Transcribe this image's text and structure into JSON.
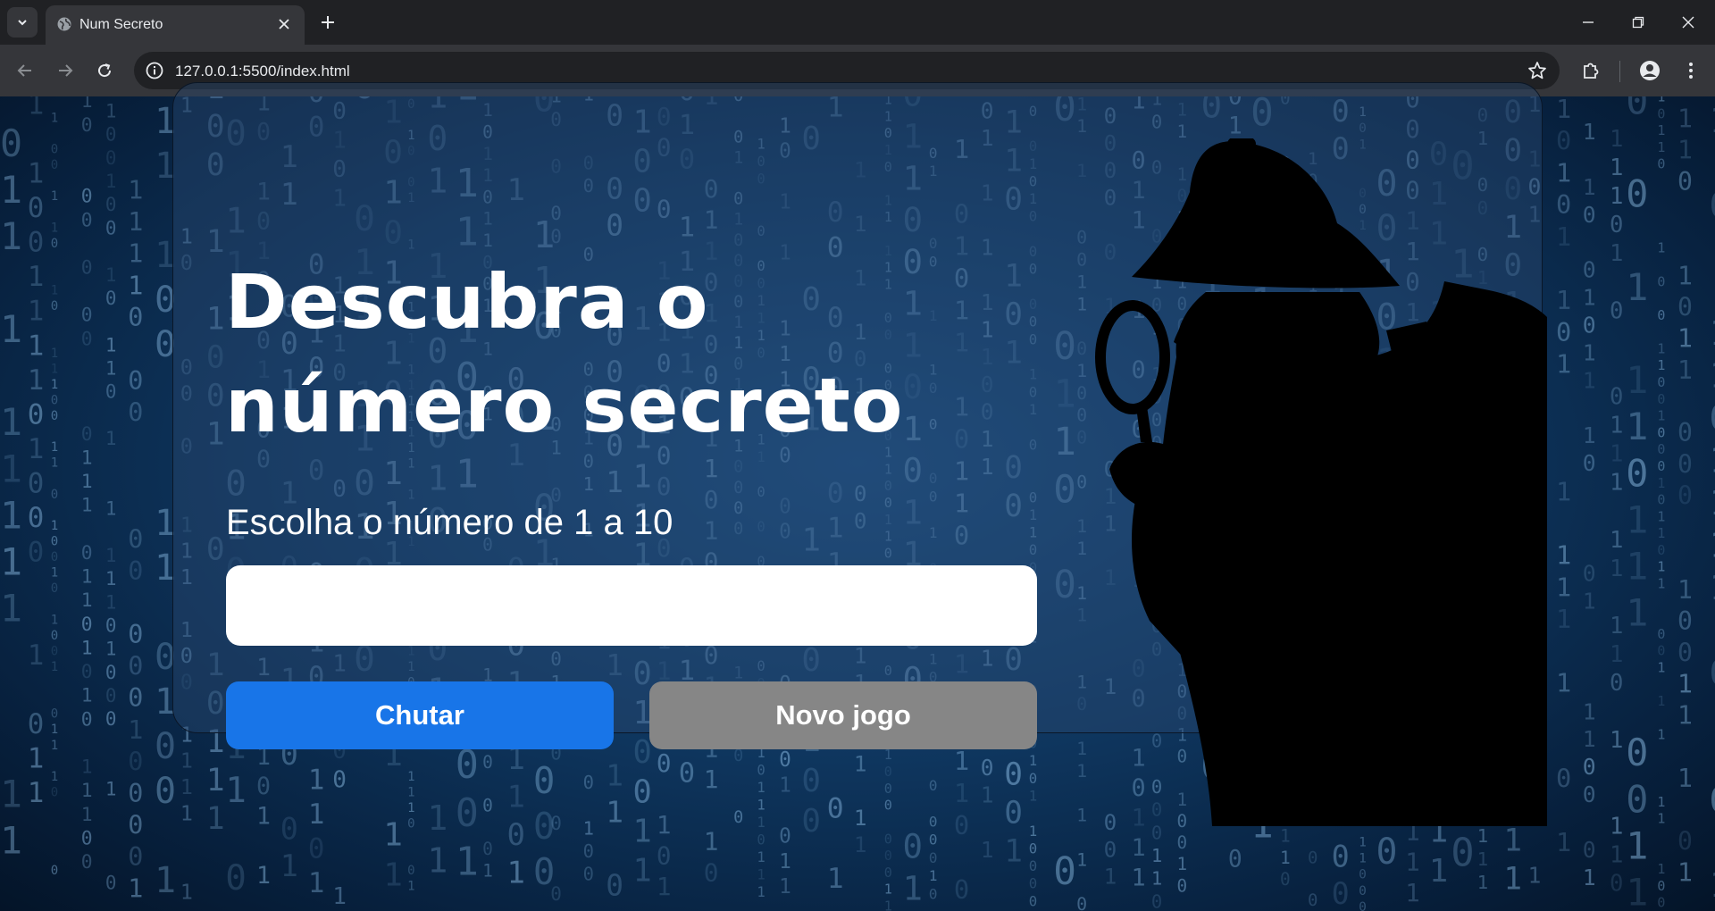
{
  "browser": {
    "tab_title": "Num Secreto",
    "url": "127.0.0.1:5500/index.html"
  },
  "page": {
    "title": "Descubra o número secreto",
    "subtitle": "Escolha o número de 1 a 10",
    "input_value": "",
    "guess_button_label": "Chutar",
    "new_game_button_label": "Novo jogo",
    "detective_image": "detective-silhouette-with-magnifying-glass",
    "background": "binary-code-rain"
  },
  "colors": {
    "guess_button": "#1875e8",
    "new_game_button": "#868686",
    "background_blue": "#0f3760"
  }
}
